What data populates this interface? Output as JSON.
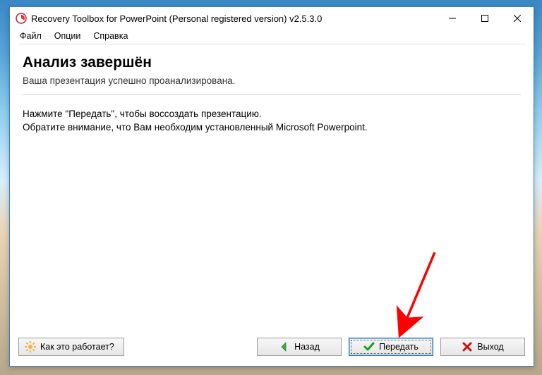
{
  "titlebar": {
    "title": "Recovery Toolbox for PowerPoint (Personal registered version) v2.5.3.0"
  },
  "menu": {
    "file": "Файл",
    "options": "Опции",
    "help": "Справка"
  },
  "main": {
    "heading": "Анализ завершён",
    "subheading": "Ваша презентация успешно проанализирована.",
    "instruction_line1": "Нажмите \"Передать\", чтобы воссоздать презентацию.",
    "instruction_line2": "Обратите внимание, что Вам необходим установленный Microsoft Powerpoint."
  },
  "footer": {
    "how_it_works": "Как это работает?",
    "back": "Назад",
    "transmit": "Передать",
    "exit": "Выход"
  }
}
